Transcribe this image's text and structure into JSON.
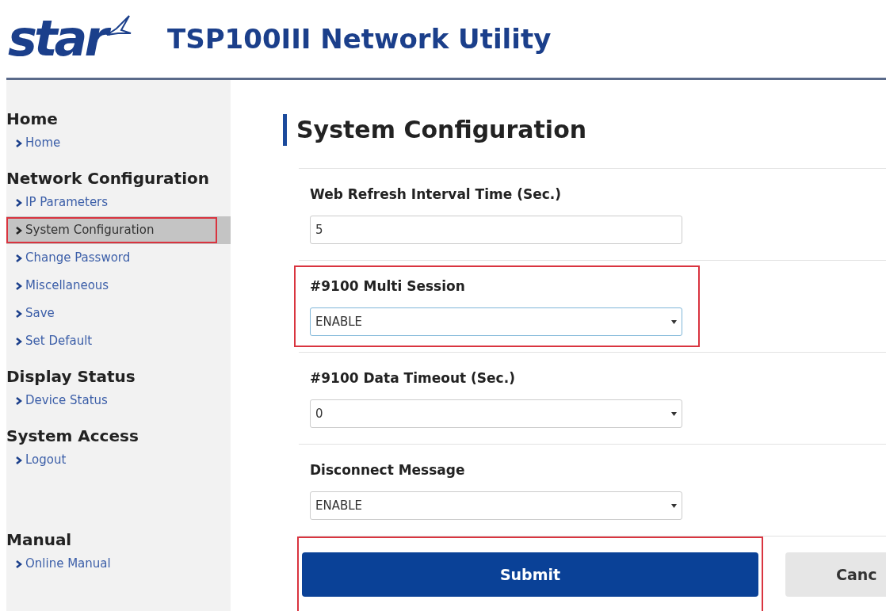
{
  "header": {
    "logo": "star",
    "title": "TSP100III Network Utility"
  },
  "sidebar": {
    "sections": [
      {
        "heading": "Home",
        "items": [
          {
            "label": "Home",
            "selected": false,
            "highlighted": false
          }
        ]
      },
      {
        "heading": "Network Configuration",
        "items": [
          {
            "label": "IP Parameters",
            "selected": false,
            "highlighted": false
          },
          {
            "label": "System Configuration",
            "selected": true,
            "highlighted": true
          },
          {
            "label": "Change Password",
            "selected": false,
            "highlighted": false
          },
          {
            "label": "Miscellaneous",
            "selected": false,
            "highlighted": false
          },
          {
            "label": "Save",
            "selected": false,
            "highlighted": false
          },
          {
            "label": "Set Default",
            "selected": false,
            "highlighted": false
          }
        ]
      },
      {
        "heading": "Display Status",
        "items": [
          {
            "label": "Device Status",
            "selected": false,
            "highlighted": false
          }
        ]
      },
      {
        "heading": "System Access",
        "items": [
          {
            "label": "Logout",
            "selected": false,
            "highlighted": false
          }
        ]
      },
      {
        "heading": "Manual",
        "items": [
          {
            "label": "Online Manual",
            "selected": false,
            "highlighted": false
          }
        ]
      }
    ]
  },
  "main": {
    "title": "System Configuration",
    "fields": [
      {
        "kind": "text",
        "label": "Web Refresh Interval Time (Sec.)",
        "value": "5",
        "highlighted": false
      },
      {
        "kind": "select",
        "label": "#9100 Multi Session",
        "value": "ENABLE",
        "highlighted": true
      },
      {
        "kind": "select",
        "label": "#9100 Data Timeout (Sec.)",
        "value": "0",
        "highlighted": false
      },
      {
        "kind": "select",
        "label": "Disconnect Message",
        "value": "ENABLE",
        "highlighted": false
      }
    ],
    "buttons": [
      {
        "kind": "primary",
        "label": "Submit",
        "highlighted": true
      },
      {
        "kind": "secondary",
        "label": "Canc",
        "highlighted": false
      }
    ]
  }
}
